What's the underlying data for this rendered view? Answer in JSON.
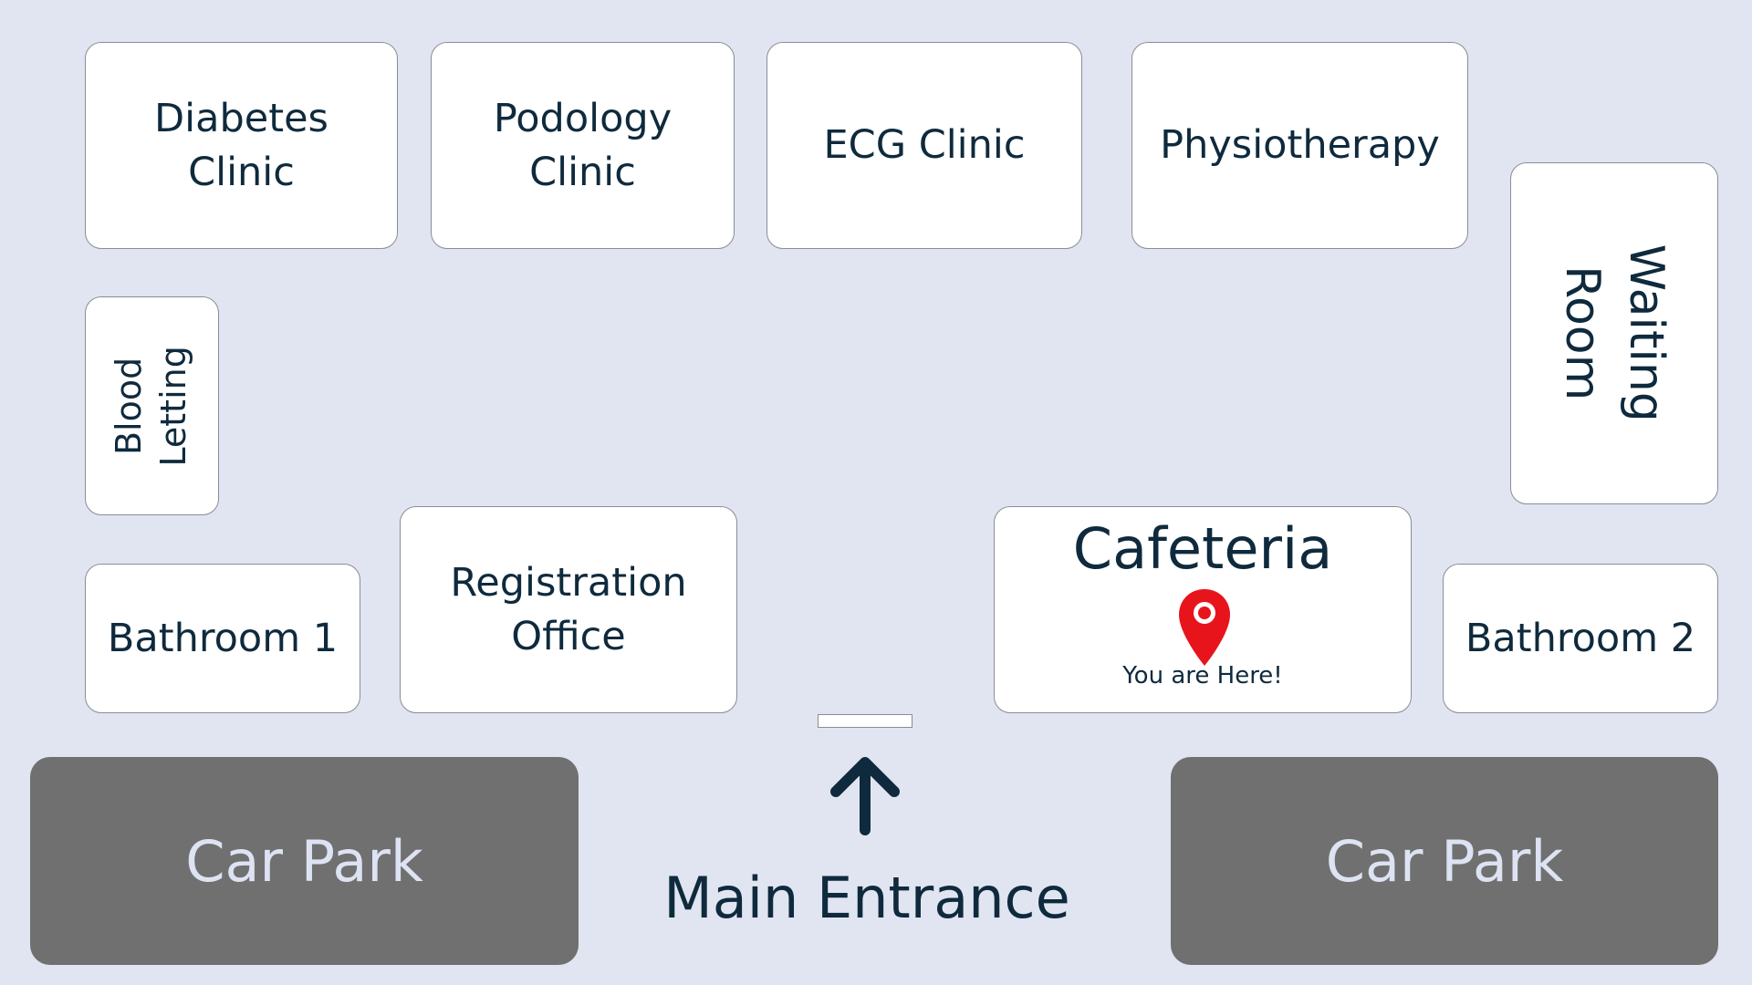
{
  "map": {
    "rooms": {
      "diabetes_clinic": "Diabetes\nClinic",
      "podology_clinic": "Podology\nClinic",
      "ecg_clinic": "ECG Clinic",
      "physiotherapy": "Physiotherapy",
      "waiting_room": "Waiting\nRoom",
      "blood_letting": "Blood\nLetting",
      "bathroom_1": "Bathroom 1",
      "registration_office": "Registration\nOffice",
      "cafeteria": "Cafeteria",
      "bathroom_2": "Bathroom 2"
    },
    "you_are_here": "You are Here!",
    "car_park_left": "Car Park",
    "car_park_right": "Car Park",
    "main_entrance": "Main Entrance",
    "icons": {
      "location_pin": "location-pin-icon",
      "arrow": "arrow-up-icon"
    },
    "colors": {
      "background": "#e1e5f1",
      "room": "#ffffff",
      "car_park": "#707070",
      "pin": "#e8141c",
      "text": "#0f2a3d"
    }
  }
}
